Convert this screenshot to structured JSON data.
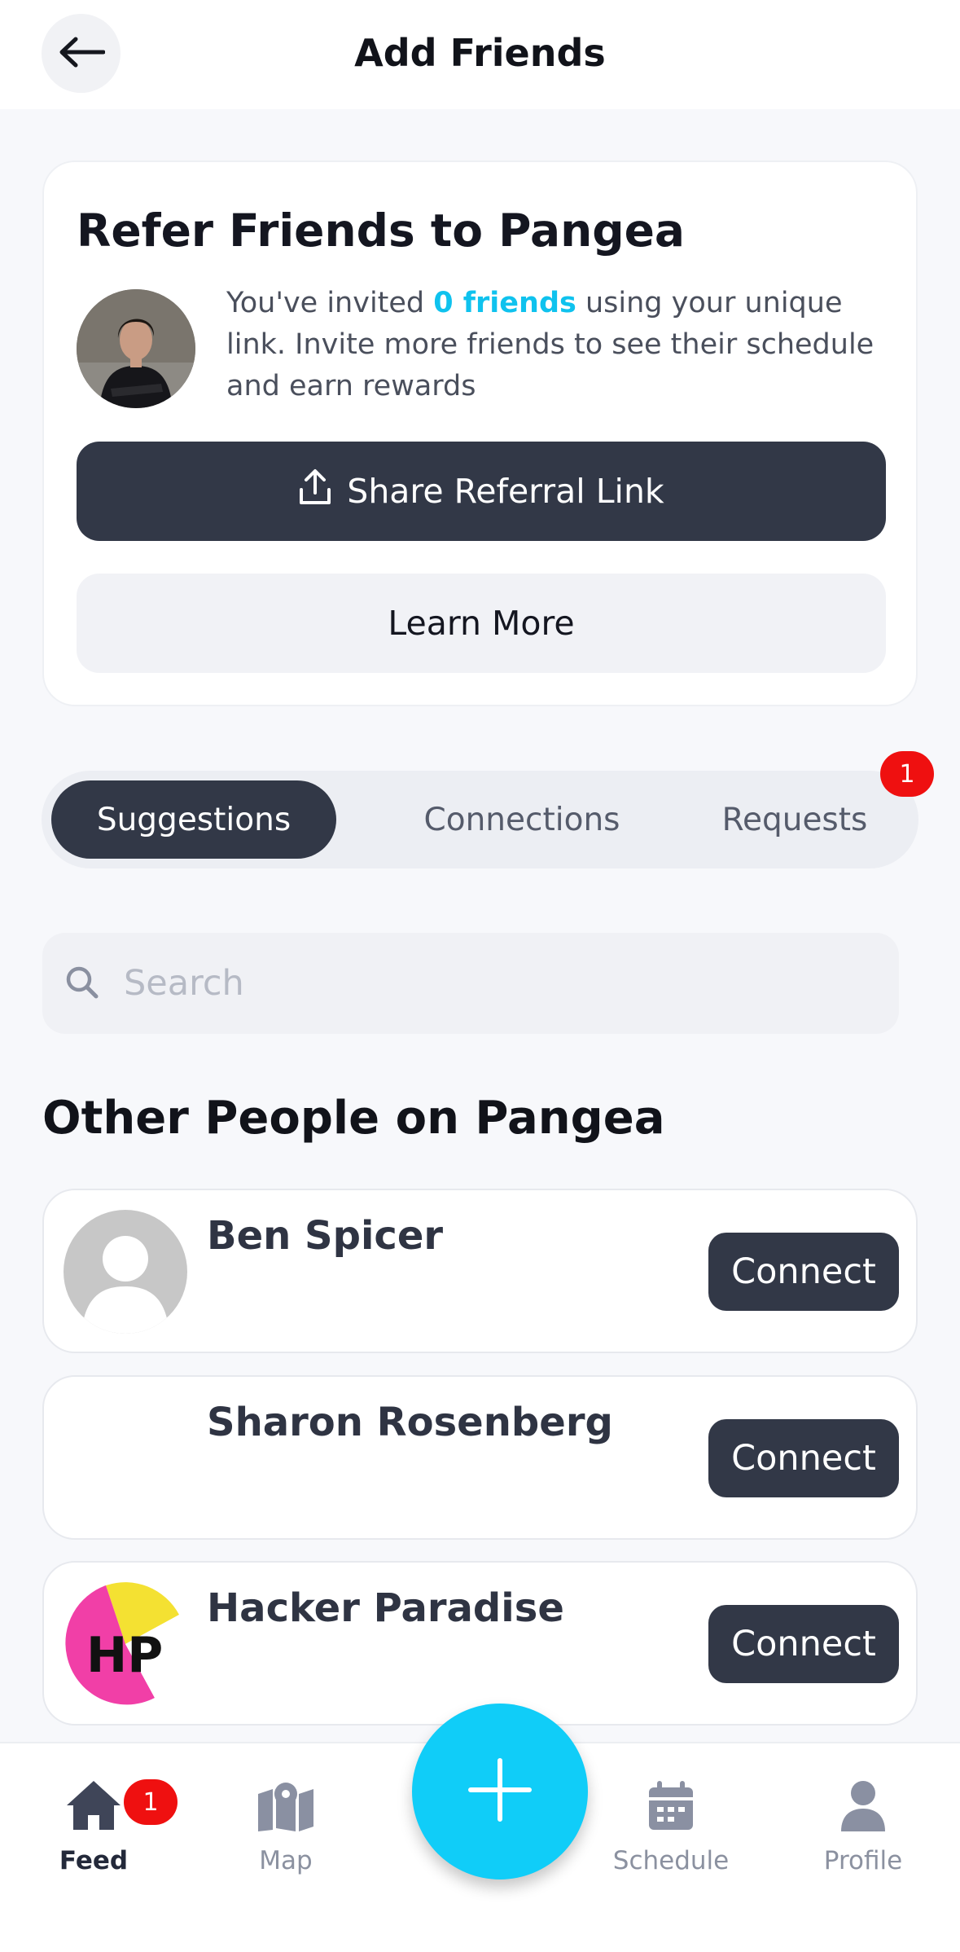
{
  "header": {
    "title": "Add Friends",
    "back_icon": "arrow-left-icon"
  },
  "referral": {
    "title": "Refer Friends to Pangea",
    "text_before": "You've invited ",
    "invited_count_text": "0 friends",
    "text_after": " using your unique link. Invite more friends to see their schedule and earn rewards",
    "share_label": "Share Referral Link",
    "share_icon": "share-upload-icon",
    "learn_more_label": "Learn More"
  },
  "tabs": {
    "items": [
      {
        "label": "Suggestions",
        "active": true
      },
      {
        "label": "Connections",
        "active": false
      },
      {
        "label": "Requests",
        "active": false
      }
    ],
    "requests_badge": "1"
  },
  "search": {
    "placeholder": "Search",
    "value": ""
  },
  "section_title": "Other People on Pangea",
  "people": [
    {
      "name": "Ben Spicer",
      "action": "Connect",
      "avatar": "default-avatar"
    },
    {
      "name": "Sharon Rosenberg",
      "action": "Connect",
      "avatar": "blank"
    },
    {
      "name": "Hacker Paradise",
      "action": "Connect",
      "avatar": "HP-logo",
      "logo_text": "HP"
    }
  ],
  "bottom_nav": {
    "items": [
      {
        "label": "Feed",
        "icon": "home-icon",
        "active": true
      },
      {
        "label": "Map",
        "icon": "map-icon",
        "active": false
      },
      {
        "label": "Schedule",
        "icon": "calendar-icon",
        "active": false
      },
      {
        "label": "Profile",
        "icon": "profile-icon",
        "active": false
      }
    ],
    "feed_badge": "1",
    "fab_icon": "plus-icon"
  },
  "colors": {
    "accent": "#0fc2ee",
    "dark_button": "#323847",
    "badge_red": "#ef1010",
    "fab": "#10cdf8"
  }
}
